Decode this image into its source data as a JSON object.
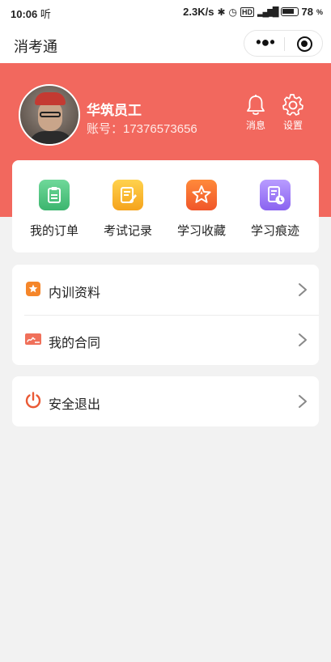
{
  "status_bar": {
    "time": "10:06",
    "time_suffix": "听",
    "speed": "2.3K/s",
    "battery": "78"
  },
  "navbar": {
    "title": "消考通"
  },
  "profile": {
    "name": "华筑员工",
    "account": "账号：17376573656"
  },
  "actions": {
    "messages_label": "消息",
    "settings_label": "设置"
  },
  "shortcuts": [
    {
      "label": "我的订单",
      "icon": "order-icon",
      "color": "#3cb56e"
    },
    {
      "label": "考试记录",
      "icon": "exam-record-icon",
      "color": "#f5a31c"
    },
    {
      "label": "学习收藏",
      "icon": "favorites-icon",
      "color": "#f0562a"
    },
    {
      "label": "学习痕迹",
      "icon": "history-icon",
      "color": "#8a63f0"
    }
  ],
  "menu": {
    "training": "内训资料",
    "contract": "我的合同",
    "logout": "安全退出"
  },
  "colors": {
    "brand": "#f2685e",
    "background": "#f2f2f2"
  }
}
